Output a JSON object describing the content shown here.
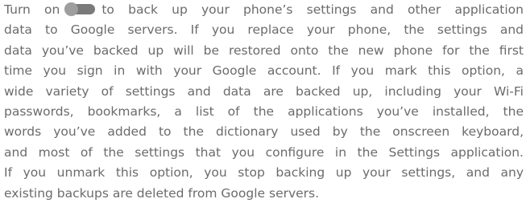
{
  "body": {
    "line_1_before_toggle": "Turn on",
    "line_1_after_toggle": "to back up your phone’s settings and other application",
    "lines": [
      "data to Google servers. If you replace your phone, the settings and",
      "data you’ve backed up will be restored onto the new phone for the first",
      "time you sign in with your Google account. If you mark this option, a",
      "wide variety of settings and data are backed up, including your Wi-Fi",
      "passwords, bookmarks, a list of the applications you’ve installed, the",
      "words you’ve added to the dictionary used by the onscreen keyboard,",
      "and most of the settings that you configure in the Settings application.",
      "If you unmark this option, you stop backing up your settings, and any",
      "existing backups are deleted from Google servers."
    ]
  },
  "toggle": {
    "icon": "toggle-switch-icon",
    "state": "off",
    "track_color": "#7a7a7a",
    "thumb_color": "#9e9e9e"
  },
  "colors": {
    "text": "#6b6b6b",
    "background": "#ffffff"
  }
}
